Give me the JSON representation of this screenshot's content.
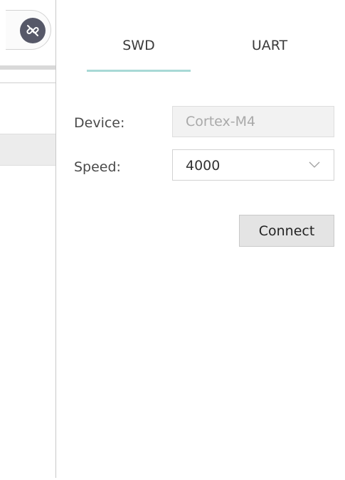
{
  "tabs": [
    {
      "label": "SWD",
      "active": true
    },
    {
      "label": "UART",
      "active": false
    }
  ],
  "form": {
    "device_label": "Device:",
    "device_value": "Cortex-M4",
    "speed_label": "Speed:",
    "speed_value": "4000"
  },
  "actions": {
    "connect_label": "Connect"
  },
  "icons": {
    "disconnect": "unlink-icon",
    "dropdown": "chevron-down-icon"
  },
  "colors": {
    "tab_underline": "#a8d9d6",
    "icon_circle": "#565868",
    "disabled_field_bg": "#f2f2f2",
    "button_bg": "#e4e4e4"
  }
}
